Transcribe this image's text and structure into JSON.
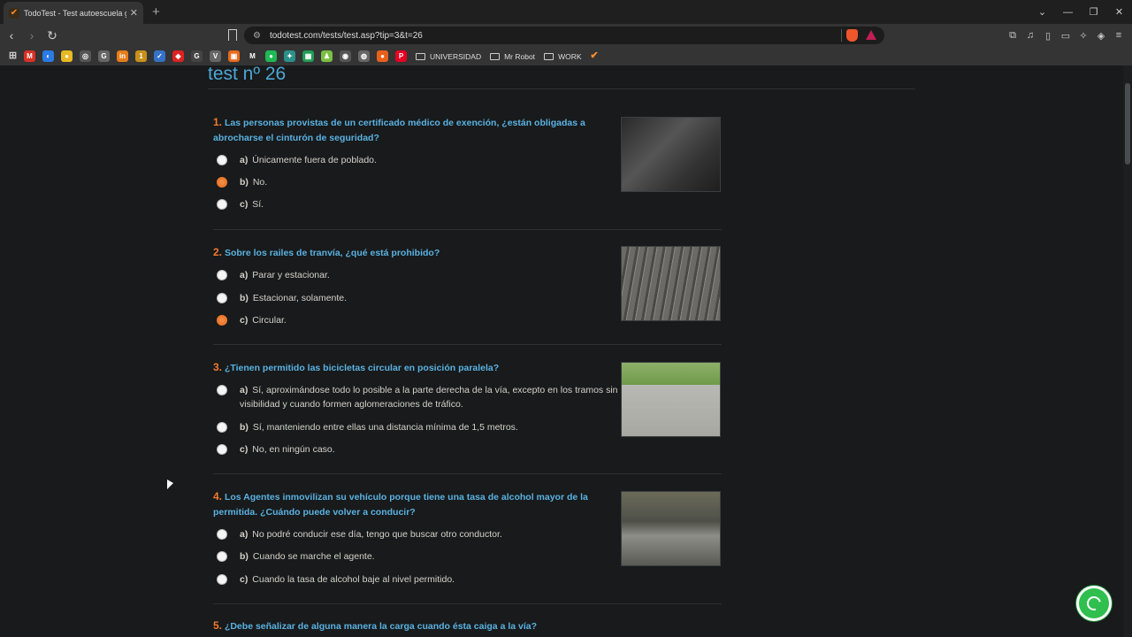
{
  "browser": {
    "tab_title": "TodoTest - Test autoescuela grat",
    "url": "todotest.com/tests/test.asp?tip=3&t=26",
    "bookmarks_folders": [
      "UNIVERSIDAD",
      "Mr Robot",
      "WORK"
    ],
    "bookmark_icons": [
      {
        "name": "gmail",
        "color": "#d93025",
        "glyph": "M"
      },
      {
        "name": "app2",
        "color": "#2a7be4",
        "glyph": "◐"
      },
      {
        "name": "chrome",
        "color": "#e8b923",
        "glyph": "●"
      },
      {
        "name": "app4",
        "color": "#555",
        "glyph": "◎"
      },
      {
        "name": "google",
        "color": "#666",
        "glyph": "G"
      },
      {
        "name": "app6",
        "color": "#e57d1a",
        "glyph": "in"
      },
      {
        "name": "app7",
        "color": "#c8901a",
        "glyph": "1"
      },
      {
        "name": "app8",
        "color": "#3572c6",
        "glyph": "✓"
      },
      {
        "name": "app9",
        "color": "#d22",
        "glyph": "◆"
      },
      {
        "name": "app10",
        "color": "#444",
        "glyph": "G"
      },
      {
        "name": "app11",
        "color": "#666",
        "glyph": "V"
      },
      {
        "name": "app12",
        "color": "#e86a1b",
        "glyph": "▣"
      },
      {
        "name": "app13",
        "color": "#333",
        "glyph": "M"
      },
      {
        "name": "spotify",
        "color": "#1db954",
        "glyph": "●"
      },
      {
        "name": "app15",
        "color": "#2c8f8a",
        "glyph": "✦"
      },
      {
        "name": "sheets",
        "color": "#1f9d55",
        "glyph": "▦"
      },
      {
        "name": "app17",
        "color": "#7bbf43",
        "glyph": "♟"
      },
      {
        "name": "app18",
        "color": "#555",
        "glyph": "◉"
      },
      {
        "name": "app19",
        "color": "#666",
        "glyph": "◍"
      },
      {
        "name": "app20",
        "color": "#e8611a",
        "glyph": "●"
      },
      {
        "name": "pinterest",
        "color": "#e60023",
        "glyph": "P"
      }
    ]
  },
  "page": {
    "title": "test nº 26",
    "questions": [
      {
        "num": "1.",
        "text": "Las personas provistas de un certificado médico de exención, ¿están obligadas a abrocharse el cinturón de seguridad?",
        "options": [
          {
            "letter": "a)",
            "text": "Únicamente fuera de poblado.",
            "selected": false
          },
          {
            "letter": "b)",
            "text": "No.",
            "selected": true
          },
          {
            "letter": "c)",
            "text": "Sí.",
            "selected": false
          }
        ]
      },
      {
        "num": "2.",
        "text": "Sobre los railes de tranvía, ¿qué está prohibido?",
        "options": [
          {
            "letter": "a)",
            "text": "Parar y estacionar.",
            "selected": false
          },
          {
            "letter": "b)",
            "text": "Estacionar, solamente.",
            "selected": false
          },
          {
            "letter": "c)",
            "text": "Circular.",
            "selected": true
          }
        ]
      },
      {
        "num": "3.",
        "text": "¿Tienen permitido las bicicletas circular en posición paralela?",
        "options": [
          {
            "letter": "a)",
            "text": "Sí, aproximándose todo lo posible a la parte derecha de la vía, excepto en los tramos sin visibilidad y cuando formen aglomeraciones de tráfico.",
            "selected": false
          },
          {
            "letter": "b)",
            "text": "Sí, manteniendo entre ellas una distancia mínima de 1,5 metros.",
            "selected": false
          },
          {
            "letter": "c)",
            "text": "No, en ningún caso.",
            "selected": false
          }
        ]
      },
      {
        "num": "4.",
        "text": "Los Agentes inmovilizan su vehículo porque tiene una tasa de alcohol mayor de la permitida. ¿Cuándo puede volver a conducir?",
        "options": [
          {
            "letter": "a)",
            "text": "No podré conducir ese día, tengo que buscar otro conductor.",
            "selected": false
          },
          {
            "letter": "b)",
            "text": "Cuando se marche el agente.",
            "selected": false
          },
          {
            "letter": "c)",
            "text": "Cuando la tasa de alcohol baje al nivel permitido.",
            "selected": false
          }
        ]
      },
      {
        "num": "5.",
        "text": "¿Debe señalizar de alguna manera la carga cuando ésta caiga a la vía?",
        "options": []
      }
    ]
  }
}
